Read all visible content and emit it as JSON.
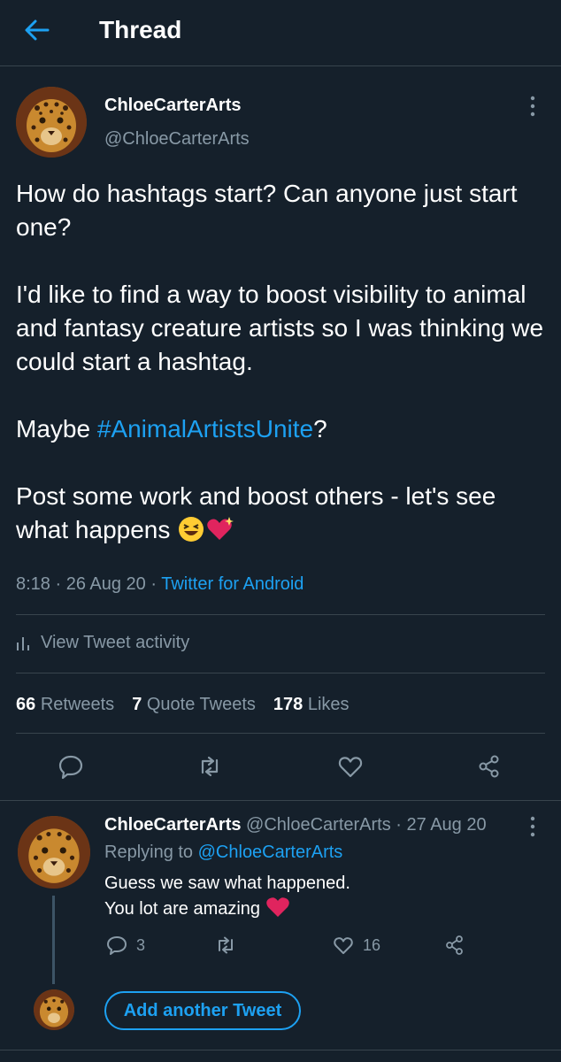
{
  "header": {
    "title": "Thread",
    "back_icon": "arrow-left-icon"
  },
  "colors": {
    "background": "#15202b",
    "accent": "#1da1f2",
    "muted": "#8899a6",
    "divider": "#38444d",
    "heart": "#e0245e"
  },
  "tweet": {
    "author_name": "ChloeCarterArts",
    "author_handle": "@ChloeCarterArts",
    "body": {
      "line1": "How do hashtags start? Can anyone just start one?",
      "line2": "I'd like to find a way to boost visibility to animal and fantasy creature artists so I was thinking we could start a hashtag.",
      "line3_prefix": "Maybe ",
      "line3_hashtag": "#AnimalArtistsUnite",
      "line3_suffix": "?",
      "line4": "Post some work and boost others - let's see what happens"
    },
    "time": "8:18",
    "date": "26 Aug 20",
    "source": "Twitter for Android",
    "activity_label": "View Tweet activity",
    "stats": {
      "retweets_count": "66",
      "retweets_label": "Retweets",
      "quotes_count": "7",
      "quotes_label": "Quote Tweets",
      "likes_count": "178",
      "likes_label": "Likes"
    }
  },
  "reply": {
    "author_name": "ChloeCarterArts",
    "author_handle": "@ChloeCarterArts",
    "date": "27 Aug 20",
    "replying_label": "Replying to",
    "replying_handle": "@ChloeCarterArts",
    "line1": "Guess we saw what happened.",
    "line2": "You lot are amazing",
    "reply_count": "3",
    "like_count": "16"
  },
  "add_button_label": "Add another Tweet"
}
